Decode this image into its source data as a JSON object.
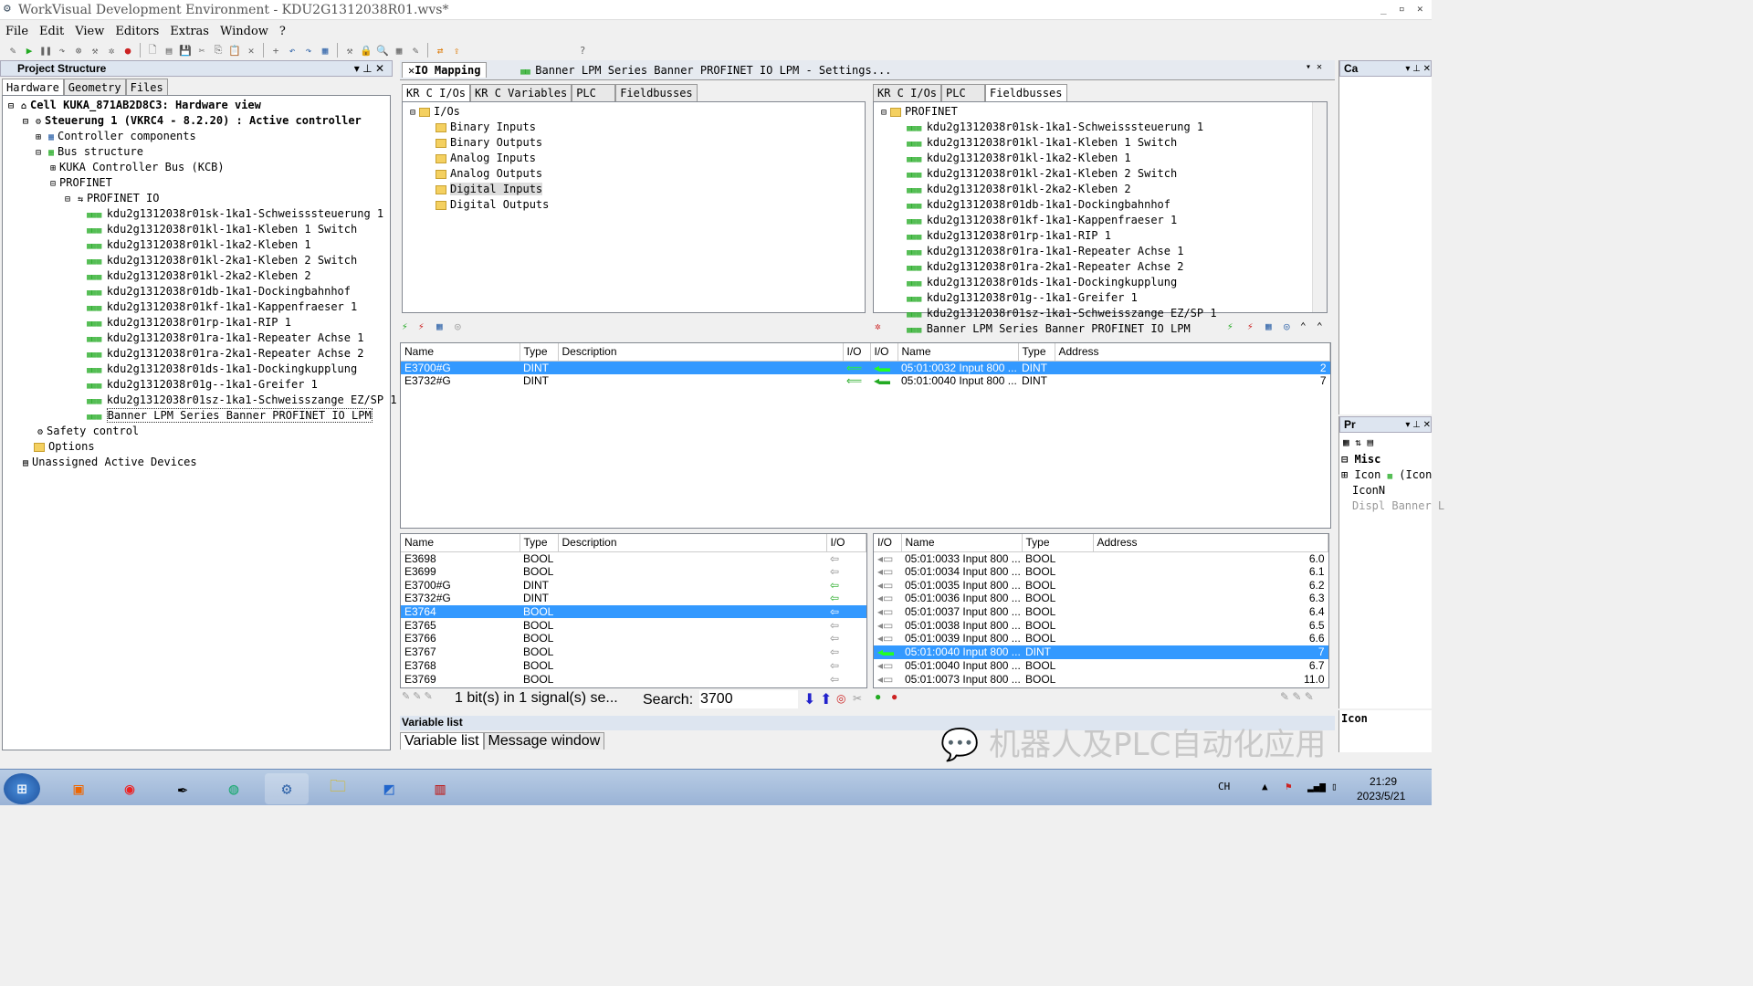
{
  "app_title": "WorkVisual Development Environment - KDU2G1312038R01.wvs*",
  "menu": [
    "File",
    "Edit",
    "View",
    "Editors",
    "Extras",
    "Window",
    "?"
  ],
  "left_panel": {
    "title": "Project Structure",
    "tabs": [
      "Hardware",
      "Geometry",
      "Files"
    ],
    "tree": [
      "Cell KUKA_871AB2D8C3: Hardware view",
      "Steuerung 1 (VKRC4 - 8.2.20) : Active controller",
      "Controller components",
      "Bus structure",
      "KUKA Controller Bus (KCB)",
      "PROFINET",
      "PROFINET IO",
      "kdu2g1312038r01sk-1ka1-Schweisssteuerung 1",
      "kdu2g1312038r01kl-1ka1-Kleben 1 Switch",
      "kdu2g1312038r01kl-1ka2-Kleben 1",
      "kdu2g1312038r01kl-2ka1-Kleben 2 Switch",
      "kdu2g1312038r01kl-2ka2-Kleben 2",
      "kdu2g1312038r01db-1ka1-Dockingbahnhof",
      "kdu2g1312038r01kf-1ka1-Kappenfraeser 1",
      "kdu2g1312038r01rp-1ka1-RIP 1",
      "kdu2g1312038r01ra-1ka1-Repeater Achse 1",
      "kdu2g1312038r01ra-2ka1-Repeater Achse 2",
      "kdu2g1312038r01ds-1ka1-Dockingkupplung",
      "kdu2g1312038r01g--1ka1-Greifer 1",
      "kdu2g1312038r01sz-1ka1-Schweisszange EZ/SP 1",
      "Banner LPM Series Banner PROFINET IO LPM",
      "Safety control",
      "Options",
      "Unassigned Active Devices"
    ]
  },
  "doc_tabs": [
    "IO Mapping",
    "Banner LPM Series Banner PROFINET IO LPM - Settings..."
  ],
  "left_io": {
    "tabs": [
      "KR C I/Os",
      "KR C Variables",
      "PLC",
      "Fieldbusses"
    ],
    "root": "I/Os",
    "items": [
      "Binary Inputs",
      "Binary Outputs",
      "Analog Inputs",
      "Analog Outputs",
      "Digital Inputs",
      "Digital Outputs"
    ]
  },
  "right_io": {
    "tabs": [
      "KR C I/Os",
      "PLC",
      "Fieldbusses"
    ],
    "root": "PROFINET",
    "items": [
      "kdu2g1312038r01sk-1ka1-Schweisssteuerung 1",
      "kdu2g1312038r01kl-1ka1-Kleben 1 Switch",
      "kdu2g1312038r01kl-1ka2-Kleben 1",
      "kdu2g1312038r01kl-2ka1-Kleben 2 Switch",
      "kdu2g1312038r01kl-2ka2-Kleben 2",
      "kdu2g1312038r01db-1ka1-Dockingbahnhof",
      "kdu2g1312038r01kf-1ka1-Kappenfraeser 1",
      "kdu2g1312038r01rp-1ka1-RIP 1",
      "kdu2g1312038r01ra-1ka1-Repeater Achse 1",
      "kdu2g1312038r01ra-2ka1-Repeater Achse 2",
      "kdu2g1312038r01ds-1ka1-Dockingkupplung",
      "kdu2g1312038r01g--1ka1-Greifer 1",
      "kdu2g1312038r01sz-1ka1-Schweisszange EZ/SP 1",
      "Banner LPM Series Banner PROFINET IO LPM"
    ]
  },
  "mapped": {
    "headers": [
      "Name",
      "Type",
      "Description",
      "I/O",
      "I/O",
      "Name",
      "Type",
      "Address"
    ],
    "rows": [
      {
        "name": "E3700#G",
        "type": "DINT",
        "rname": "05:01:0032 Input 800 ...",
        "rtype": "DINT",
        "addr": "2",
        "sel": true
      },
      {
        "name": "E3732#G",
        "type": "DINT",
        "rname": "05:01:0040 Input 800 ...",
        "rtype": "DINT",
        "addr": "7",
        "sel": false
      }
    ]
  },
  "lower_left": {
    "headers": [
      "Name",
      "Type",
      "Description",
      "I/O"
    ],
    "rows": [
      {
        "name": "E3698",
        "type": "BOOL"
      },
      {
        "name": "E3699",
        "type": "BOOL"
      },
      {
        "name": "E3700#G",
        "type": "DINT"
      },
      {
        "name": "E3732#G",
        "type": "DINT"
      },
      {
        "name": "E3764",
        "type": "BOOL"
      },
      {
        "name": "E3765",
        "type": "BOOL"
      },
      {
        "name": "E3766",
        "type": "BOOL"
      },
      {
        "name": "E3767",
        "type": "BOOL"
      },
      {
        "name": "E3768",
        "type": "BOOL"
      },
      {
        "name": "E3769",
        "type": "BOOL"
      }
    ]
  },
  "lower_right": {
    "headers": [
      "I/O",
      "Name",
      "Type",
      "Address"
    ],
    "rows": [
      {
        "name": "05:01:0033 Input 800 ...",
        "type": "BOOL",
        "addr": "6.0"
      },
      {
        "name": "05:01:0034 Input 800 ...",
        "type": "BOOL",
        "addr": "6.1"
      },
      {
        "name": "05:01:0035 Input 800 ...",
        "type": "BOOL",
        "addr": "6.2"
      },
      {
        "name": "05:01:0036 Input 800 ...",
        "type": "BOOL",
        "addr": "6.3"
      },
      {
        "name": "05:01:0037 Input 800 ...",
        "type": "BOOL",
        "addr": "6.4"
      },
      {
        "name": "05:01:0038 Input 800 ...",
        "type": "BOOL",
        "addr": "6.5"
      },
      {
        "name": "05:01:0039 Input 800 ...",
        "type": "BOOL",
        "addr": "6.6"
      },
      {
        "name": "05:01:0040 Input 800 ...",
        "type": "DINT",
        "addr": "7"
      },
      {
        "name": "05:01:0040 Input 800 ...",
        "type": "BOOL",
        "addr": "6.7"
      },
      {
        "name": "05:01:0073 Input 800 ...",
        "type": "BOOL",
        "addr": "11.0"
      }
    ]
  },
  "status": {
    "bits": "1 bit(s) in 1 signal(s) se...",
    "search_label": "Search:",
    "search_value": "3700"
  },
  "variable_list": {
    "title": "Variable list",
    "tabs": [
      "Variable list",
      "Message window"
    ]
  },
  "right_side": {
    "ca": "Ca",
    "pr": "Pr",
    "misc": "Misc",
    "icon": "Icon",
    "icon_val": "(Icon",
    "iconn": "IconN",
    "displ": "Displ",
    "displ_val": "Banner L",
    "icon_footer": "Icon"
  },
  "watermark": "机器人及PLC自动化应用",
  "tray": {
    "lang": "CH",
    "time": "21:29",
    "date": "2023/5/21"
  }
}
